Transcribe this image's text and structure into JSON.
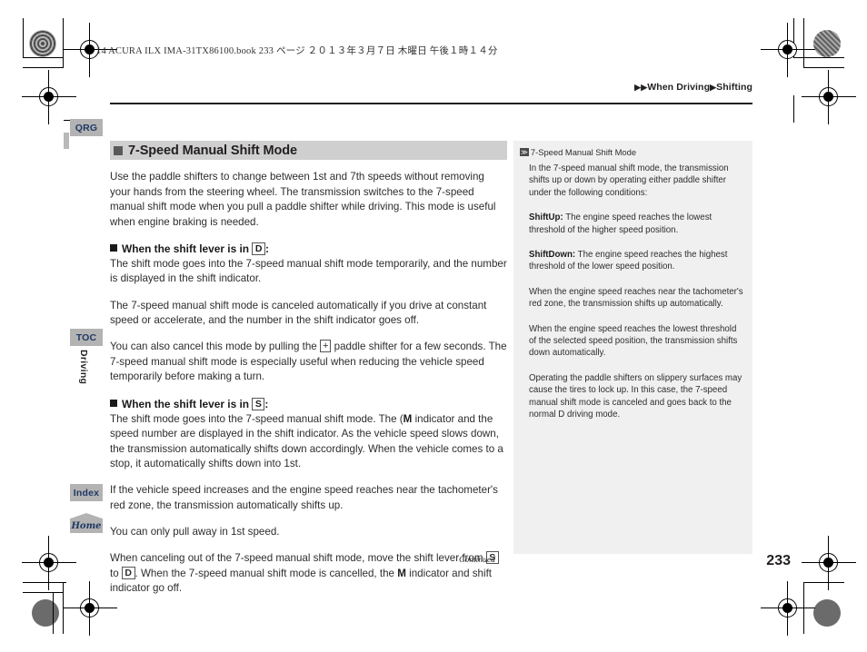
{
  "print_slug": "14 ACURA ILX IMA-31TX86100.book   233 ページ   ２０１３年３月７日   木曜日   午後１時１４分",
  "breadcrumb": {
    "arrow_double": "▶▶",
    "level1": "When Driving",
    "arrow_single": "▶",
    "level2": "Shifting"
  },
  "tabs": {
    "qrg": "QRG",
    "toc": "TOC",
    "index": "Index",
    "home": "Home"
  },
  "side_chapter": "Driving",
  "main": {
    "section_title": "7-Speed Manual Shift Mode",
    "intro": "Use the paddle shifters to change between 1st and 7th speeds without removing your hands from the steering wheel. The transmission switches to the 7-speed manual shift mode when you pull a paddle shifter while driving. This mode is useful when engine braking is needed.",
    "sub1_prefix": "When the shift lever is in",
    "sub1_gear": "D",
    "sub1_suffix": ":",
    "p1": "The shift mode goes into the 7-speed manual shift mode temporarily, and the number is displayed in the shift indicator.",
    "p2": "The 7-speed manual shift mode is canceled automatically if you drive at constant speed or accelerate, and the number in the shift indicator goes off.",
    "p3_a": "You can also cancel this mode by pulling the",
    "p3_gear": "+",
    "p3_b": "paddle shifter for a few seconds. The 7-speed manual shift mode is especially useful when reducing the vehicle speed temporarily before making a turn.",
    "sub2_prefix": "When the shift lever is in",
    "sub2_gear": "S",
    "sub2_suffix": ":",
    "p4_a": "The shift mode goes into the 7-speed manual shift mode. The (",
    "p4_m": "M",
    "p4_b": "indicator and the speed number are displayed in the shift indicator. As the vehicle speed slows down, the transmission automatically shifts down accordingly. When the vehicle comes to a stop, it automatically shifts down into 1st.",
    "p5": "If the vehicle speed increases and the engine speed reaches near the tachometer's red zone, the transmission automatically shifts up.",
    "p6": "You can only pull away in 1st speed.",
    "p7_a": "When canceling out of the 7-speed manual shift mode, move the shift lever from",
    "p7_gear1": "S",
    "p7_b": "to",
    "p7_gear2": "D",
    "p7_c": ". When the 7-speed manual shift mode is cancelled, the",
    "p7_m": "M",
    "p7_d": "indicator and shift indicator go off."
  },
  "note": {
    "chevron": "≫",
    "title": "7-Speed Manual Shift Mode",
    "p1": "In the 7-speed manual shift mode, the transmission shifts up or down by operating either paddle shifter under the following conditions:",
    "shiftup_label": "ShiftUp:",
    "shiftup_text": "The engine speed reaches the lowest threshold of the higher speed position.",
    "shiftdown_label": "ShiftDown:",
    "shiftdown_text": "The engine speed reaches the highest threshold of the lower speed position.",
    "p2": "When the engine speed reaches near the tachometer's red zone, the transmission shifts up automatically.",
    "p3": "When the engine speed reaches the lowest threshold of the selected speed position, the transmission shifts down automatically.",
    "p4": "Operating the paddle shifters on slippery surfaces may cause the tires to lock up. In this case, the 7-speed manual shift mode is canceled and goes back to the normal D driving mode."
  },
  "footer": {
    "continued": "Continued",
    "page_number": "233"
  },
  "colors": {
    "section_title_bg": "#cfcfcf",
    "note_bg": "#f0f0f0",
    "tab_bg": "#b3b3b3",
    "tab_text": "#1f3864",
    "body_text": "#2d2d2d"
  }
}
